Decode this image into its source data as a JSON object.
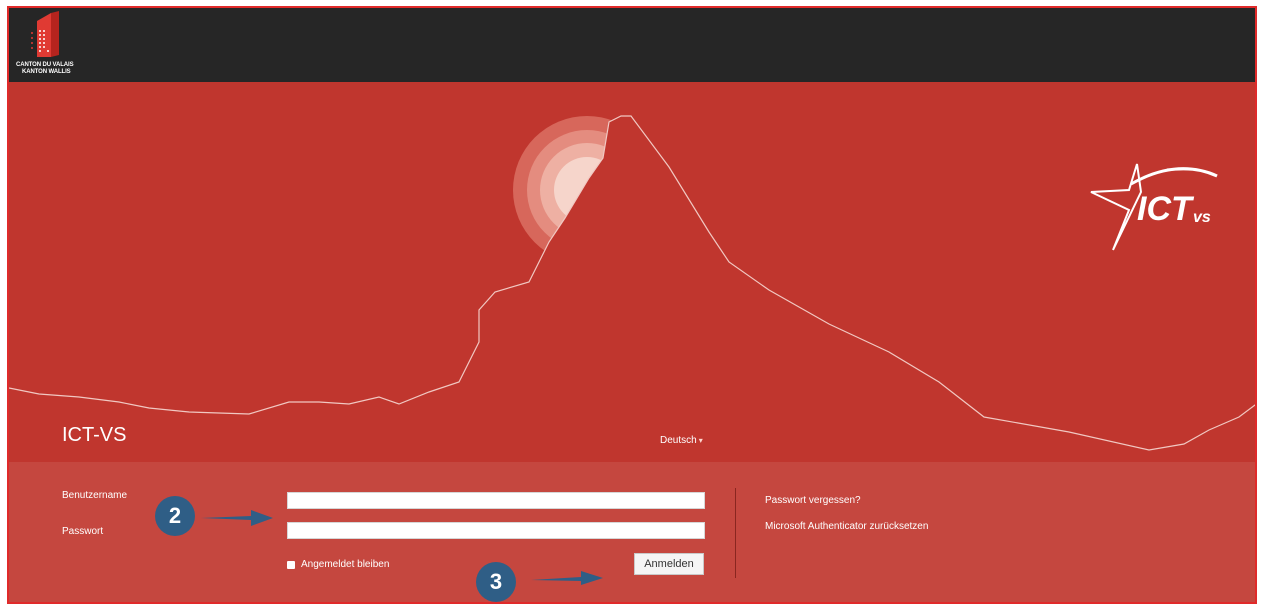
{
  "header": {
    "logo_line1": "CANTON DU VALAIS",
    "logo_line2": "KANTON WALLIS"
  },
  "hero": {
    "app_title": "ICT-VS",
    "language": "Deutsch",
    "ict_logo_main": "ICT",
    "ict_logo_sub": "vs"
  },
  "login": {
    "username_label": "Benutzername",
    "password_label": "Passwort",
    "username_value": "",
    "password_value": "",
    "remember_label": "Angemeldet bleiben",
    "remember_checked": false,
    "submit_label": "Anmelden",
    "forgot_password": "Passwort vergessen?",
    "reset_authenticator": "Microsoft Authenticator zurücksetzen"
  },
  "annotations": {
    "step_username": "2",
    "step_submit": "3",
    "badge_color": "#2f5e86"
  },
  "colors": {
    "brand_red": "#c0362e",
    "panel_red": "#c5473f",
    "topbar": "#262626"
  }
}
